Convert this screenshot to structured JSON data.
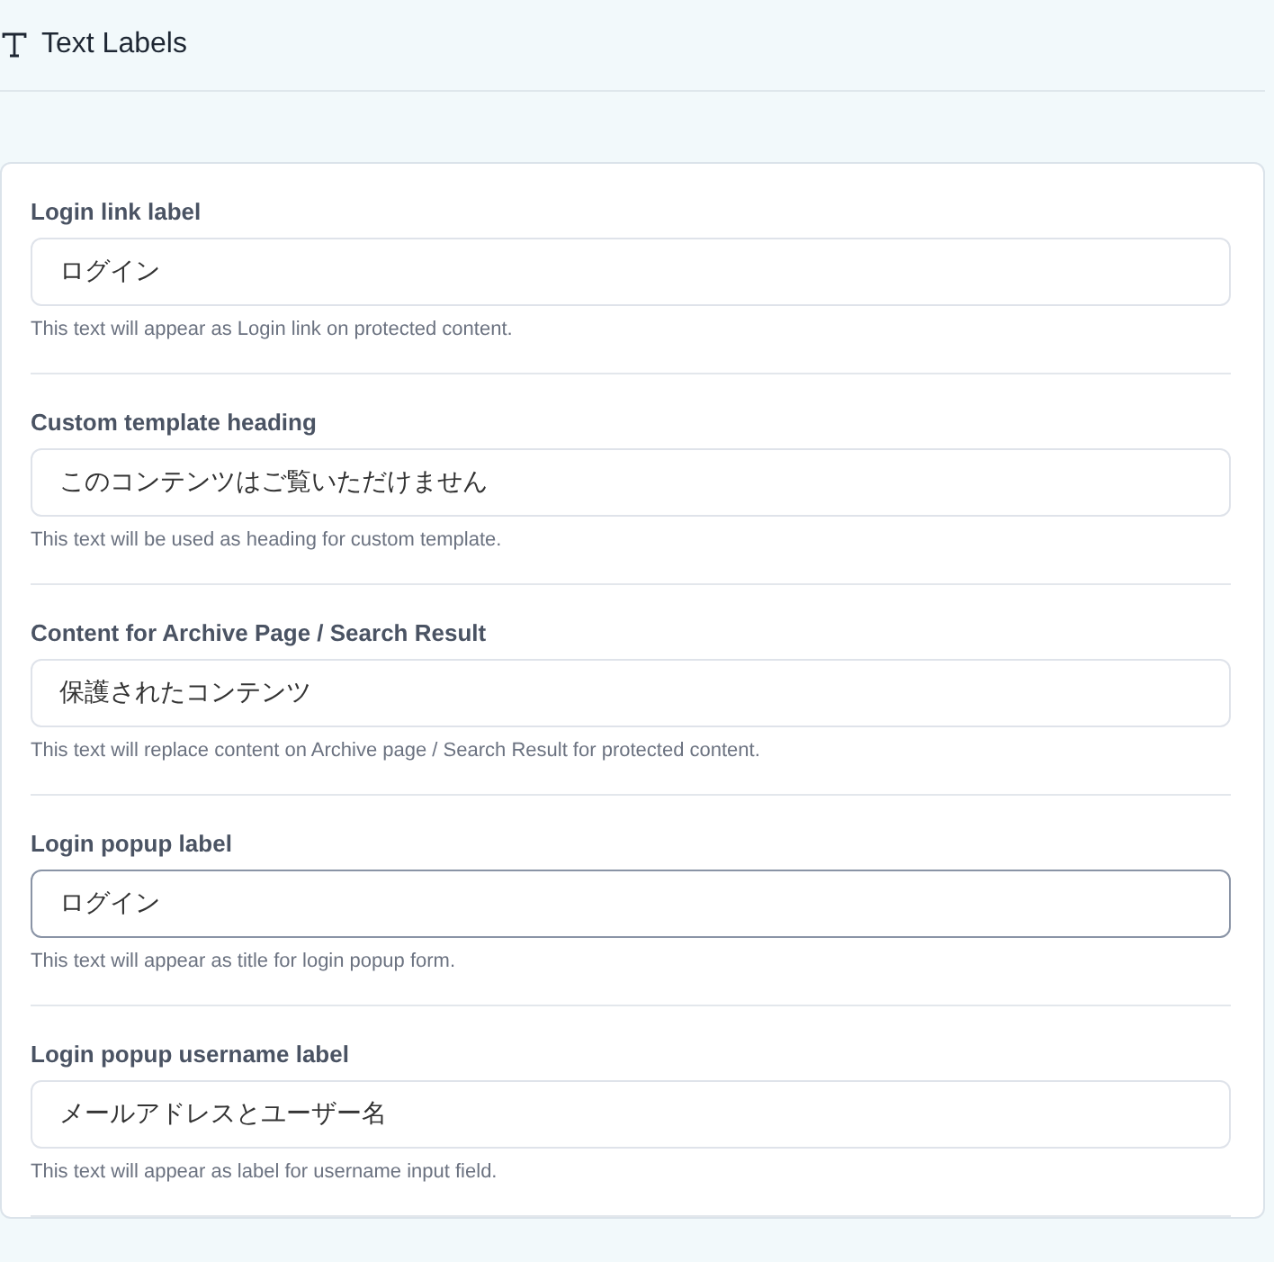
{
  "header": {
    "title": "Text Labels"
  },
  "fields": [
    {
      "label": "Login link label",
      "value": "ログイン",
      "help": "This text will appear as Login link on protected content.",
      "focused": false
    },
    {
      "label": "Custom template heading",
      "value": "このコンテンツはご覧いただけません",
      "help": "This text will be used as heading for custom template.",
      "focused": false
    },
    {
      "label": "Content for Archive Page / Search Result",
      "value": "保護されたコンテンツ",
      "help": "This text will replace content on Archive page / Search Result for protected content.",
      "focused": false
    },
    {
      "label": "Login popup label",
      "value": "ログイン",
      "help": "This text will appear as title for login popup form.",
      "focused": true
    },
    {
      "label": "Login popup username label",
      "value": "メールアドレスとユーザー名",
      "help": "This text will appear as label for username input field.",
      "focused": false
    }
  ]
}
